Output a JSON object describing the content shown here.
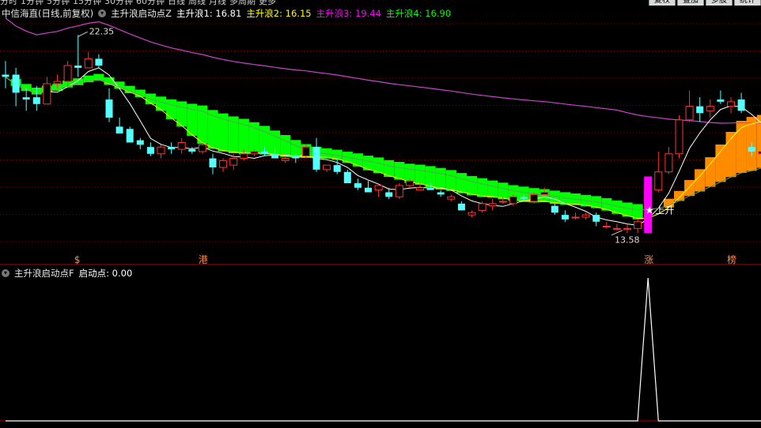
{
  "topbar": {
    "menus": [
      "分时",
      "1分钟",
      "5分钟",
      "15分钟",
      "30分钟",
      "60分钟",
      "日线",
      "周线",
      "月线",
      "多周期",
      "更多"
    ],
    "buttons": [
      "复权",
      "叠加",
      "多股",
      "统计"
    ]
  },
  "header": {
    "stock": "中信海直(日线,前复权)",
    "indicator": "主升浪启动点Z",
    "w1": "主升浪1: 16.81",
    "w2": "主升浪2: 16.15",
    "w3": "主升浪3: 19.44",
    "w4": "主升浪4: 16.90"
  },
  "sub_header": {
    "indicator": "主升浪启动点F",
    "value": "启动点: 0.00"
  },
  "colors": {
    "up": "#ff3232",
    "down": "#54ffff",
    "green_band": "#00ff00",
    "orange_band": "#ff8c00",
    "magenta": "#ff00ff",
    "ma_white": "#ffffff",
    "ma_yellow": "#ffff00",
    "ma_green": "#00ff00",
    "ma_purple": "#cc44cc"
  },
  "chart_data": [
    {
      "type": "candlestick",
      "title": "中信海直(日线,前复权)",
      "ylim": [
        12.8,
        23.2
      ],
      "candles": [
        [
          20.6,
          21.2,
          20.0,
          20.5
        ],
        [
          20.6,
          20.9,
          19.2,
          19.8
        ],
        [
          19.6,
          20.0,
          19.0,
          19.5
        ],
        [
          19.6,
          20.1,
          19.0,
          19.3
        ],
        [
          19.3,
          20.5,
          19.3,
          20.2
        ],
        [
          20.2,
          20.6,
          20.0,
          20.3
        ],
        [
          20.3,
          21.2,
          20.0,
          21.0
        ],
        [
          21.0,
          22.35,
          20.5,
          20.9
        ],
        [
          20.9,
          21.6,
          20.9,
          21.3
        ],
        [
          21.3,
          21.5,
          20.9,
          21.0
        ],
        [
          19.5,
          20.0,
          18.5,
          18.7
        ],
        [
          18.3,
          18.7,
          18.0,
          18.0
        ],
        [
          18.2,
          18.3,
          17.6,
          17.6
        ],
        [
          17.7,
          17.8,
          17.3,
          17.5
        ],
        [
          17.4,
          17.6,
          17.0,
          17.1
        ],
        [
          17.1,
          17.5,
          16.9,
          17.4
        ],
        [
          17.4,
          17.6,
          17.1,
          17.3
        ],
        [
          17.3,
          17.8,
          17.1,
          17.6
        ],
        [
          17.3,
          17.4,
          17.1,
          17.2
        ],
        [
          17.2,
          17.6,
          17.1,
          17.5
        ],
        [
          16.9,
          17.1,
          16.2,
          16.5
        ],
        [
          16.5,
          16.9,
          16.3,
          16.8
        ],
        [
          16.6,
          17.1,
          16.4,
          16.9
        ],
        [
          16.9,
          17.3,
          16.8,
          17.1
        ],
        [
          17.1,
          17.3,
          17.0,
          17.2
        ],
        [
          17.2,
          17.4,
          17.0,
          17.1
        ],
        [
          17.1,
          17.4,
          16.9,
          16.9
        ],
        [
          16.8,
          17.0,
          16.7,
          16.9
        ],
        [
          17.0,
          17.1,
          16.7,
          16.9
        ],
        [
          17.0,
          17.5,
          16.9,
          17.4
        ],
        [
          17.4,
          17.8,
          16.3,
          16.4
        ],
        [
          16.4,
          16.6,
          16.3,
          16.6
        ],
        [
          16.6,
          16.9,
          16.2,
          16.3
        ],
        [
          16.3,
          16.4,
          15.8,
          15.8
        ],
        [
          15.8,
          16.0,
          15.5,
          15.6
        ],
        [
          15.6,
          15.9,
          15.4,
          15.4
        ],
        [
          15.5,
          15.7,
          15.2,
          15.7
        ],
        [
          15.4,
          15.6,
          15.1,
          15.2
        ],
        [
          15.2,
          15.8,
          15.1,
          15.7
        ],
        [
          15.7,
          16.0,
          15.6,
          15.9
        ],
        [
          15.5,
          15.8,
          15.5,
          15.6
        ],
        [
          15.6,
          15.8,
          15.5,
          15.5
        ],
        [
          15.4,
          15.5,
          15.2,
          15.3
        ],
        [
          15.1,
          15.3,
          15.0,
          15.2
        ],
        [
          14.9,
          15.0,
          14.6,
          14.6
        ],
        [
          14.4,
          14.6,
          14.3,
          14.5
        ],
        [
          14.6,
          15.0,
          14.5,
          14.9
        ],
        [
          14.8,
          15.1,
          14.6,
          14.9
        ],
        [
          15.0,
          15.2,
          14.9,
          15.0
        ],
        [
          14.9,
          15.3,
          14.8,
          15.2
        ],
        [
          15.2,
          15.3,
          15.0,
          15.1
        ],
        [
          15.0,
          15.4,
          14.9,
          15.3
        ],
        [
          15.3,
          15.6,
          15.3,
          15.4
        ],
        [
          14.8,
          14.9,
          14.4,
          14.5
        ],
        [
          14.4,
          14.6,
          14.1,
          14.2
        ],
        [
          14.3,
          14.5,
          14.2,
          14.3
        ],
        [
          14.3,
          14.5,
          14.2,
          14.4
        ],
        [
          14.4,
          14.5,
          13.9,
          14.1
        ],
        [
          13.9,
          14.1,
          13.8,
          13.9
        ],
        [
          13.8,
          14.0,
          13.7,
          13.8
        ],
        [
          13.8,
          14.0,
          13.6,
          13.8
        ],
        [
          13.8,
          14.2,
          13.6,
          14.1
        ],
        [
          14.1,
          15.6,
          14.1,
          15.5
        ],
        [
          15.5,
          17.2,
          15.4,
          16.3
        ],
        [
          16.3,
          17.4,
          16.2,
          17.1
        ],
        [
          17.1,
          18.8,
          16.9,
          18.6
        ],
        [
          18.6,
          19.9,
          18.5,
          19.2
        ],
        [
          19.2,
          19.6,
          18.5,
          18.9
        ],
        [
          19.0,
          19.5,
          18.7,
          19.2
        ],
        [
          19.5,
          19.9,
          19.3,
          19.4
        ],
        [
          19.2,
          19.6,
          18.9,
          19.4
        ],
        [
          19.5,
          19.8,
          18.9,
          19.0
        ],
        [
          17.4,
          17.6,
          17.0,
          17.2
        ],
        [
          17.1,
          17.4,
          16.9,
          17.2
        ]
      ],
      "annotations": [
        {
          "text": "22.35",
          "index": 7,
          "price": 22.35
        },
        {
          "text": "13.58",
          "index": 60,
          "price": 13.58
        },
        {
          "text": "上升",
          "index": 62,
          "price": 14.6
        }
      ],
      "bottom_labels": [
        {
          "text": "$",
          "index": 7
        },
        {
          "text": "港",
          "index": 19
        },
        {
          "text": "涨",
          "index": 62
        },
        {
          "text": "榜",
          "index": 70
        }
      ]
    },
    {
      "type": "line",
      "title": "主升浪启动点F",
      "series": [
        {
          "name": "启动点",
          "values": [
            0,
            0,
            0,
            0,
            0,
            0,
            0,
            0,
            0,
            0,
            0,
            0,
            0,
            0,
            0,
            0,
            0,
            0,
            0,
            0,
            0,
            0,
            0,
            0,
            0,
            0,
            0,
            0,
            0,
            0,
            0,
            0,
            0,
            0,
            0,
            0,
            0,
            0,
            0,
            0,
            0,
            0,
            0,
            0,
            0,
            0,
            0,
            0,
            0,
            0,
            0,
            0,
            0,
            0,
            0,
            0,
            0,
            0,
            0,
            0,
            0,
            0,
            1,
            0,
            0,
            0,
            0,
            0,
            0,
            0,
            0,
            0,
            0,
            0
          ]
        }
      ]
    }
  ]
}
